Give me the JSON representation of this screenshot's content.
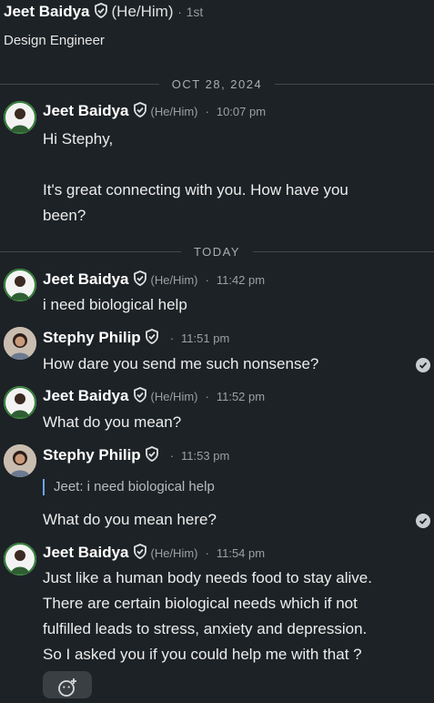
{
  "header": {
    "name": "Jeet Baidya",
    "pronouns": "(He/Him)",
    "separator": "·",
    "connection": "1st",
    "headline": "Design Engineer"
  },
  "dividers": [
    "OCT 28, 2024",
    "TODAY"
  ],
  "messages": [
    {
      "sender": "Jeet Baidya",
      "pronouns": "(He/Him)",
      "separator": "·",
      "time": "10:07 pm",
      "lines": [
        "Hi Stephy,",
        "",
        "It's great connecting with you. How have you",
        "been?"
      ]
    },
    {
      "sender": "Jeet Baidya",
      "pronouns": "(He/Him)",
      "separator": "·",
      "time": "11:42 pm",
      "lines": [
        "i need biological help"
      ]
    },
    {
      "sender": "Stephy Philip",
      "separator": "·",
      "time": "11:51 pm",
      "lines": [
        "How dare you send me such nonsense?"
      ]
    },
    {
      "sender": "Jeet Baidya",
      "pronouns": "(He/Him)",
      "separator": "·",
      "time": "11:52 pm",
      "lines": [
        "What do you mean?"
      ]
    },
    {
      "sender": "Stephy Philip",
      "separator": "·",
      "time": "11:53 pm",
      "quote": "Jeet: i need biological help",
      "lines": [
        "What do you mean here?"
      ]
    },
    {
      "sender": "Jeet Baidya",
      "pronouns": "(He/Him)",
      "separator": "·",
      "time": "11:54 pm",
      "lines": [
        "Just like a human body needs food to stay alive.",
        "There are certain biological needs which if not",
        "fulfilled leads to stress, anxiety and depression.",
        "So I asked you if you could help me with that ?"
      ]
    }
  ],
  "icons": {
    "verified": "shield-check-icon",
    "read_receipt": "check-circle-icon",
    "add_reaction": "add-emoji-icon"
  },
  "colors": {
    "background": "#1d2226",
    "quote_bar": "#6aa6e8",
    "muted_text": "#9aa0a4"
  }
}
